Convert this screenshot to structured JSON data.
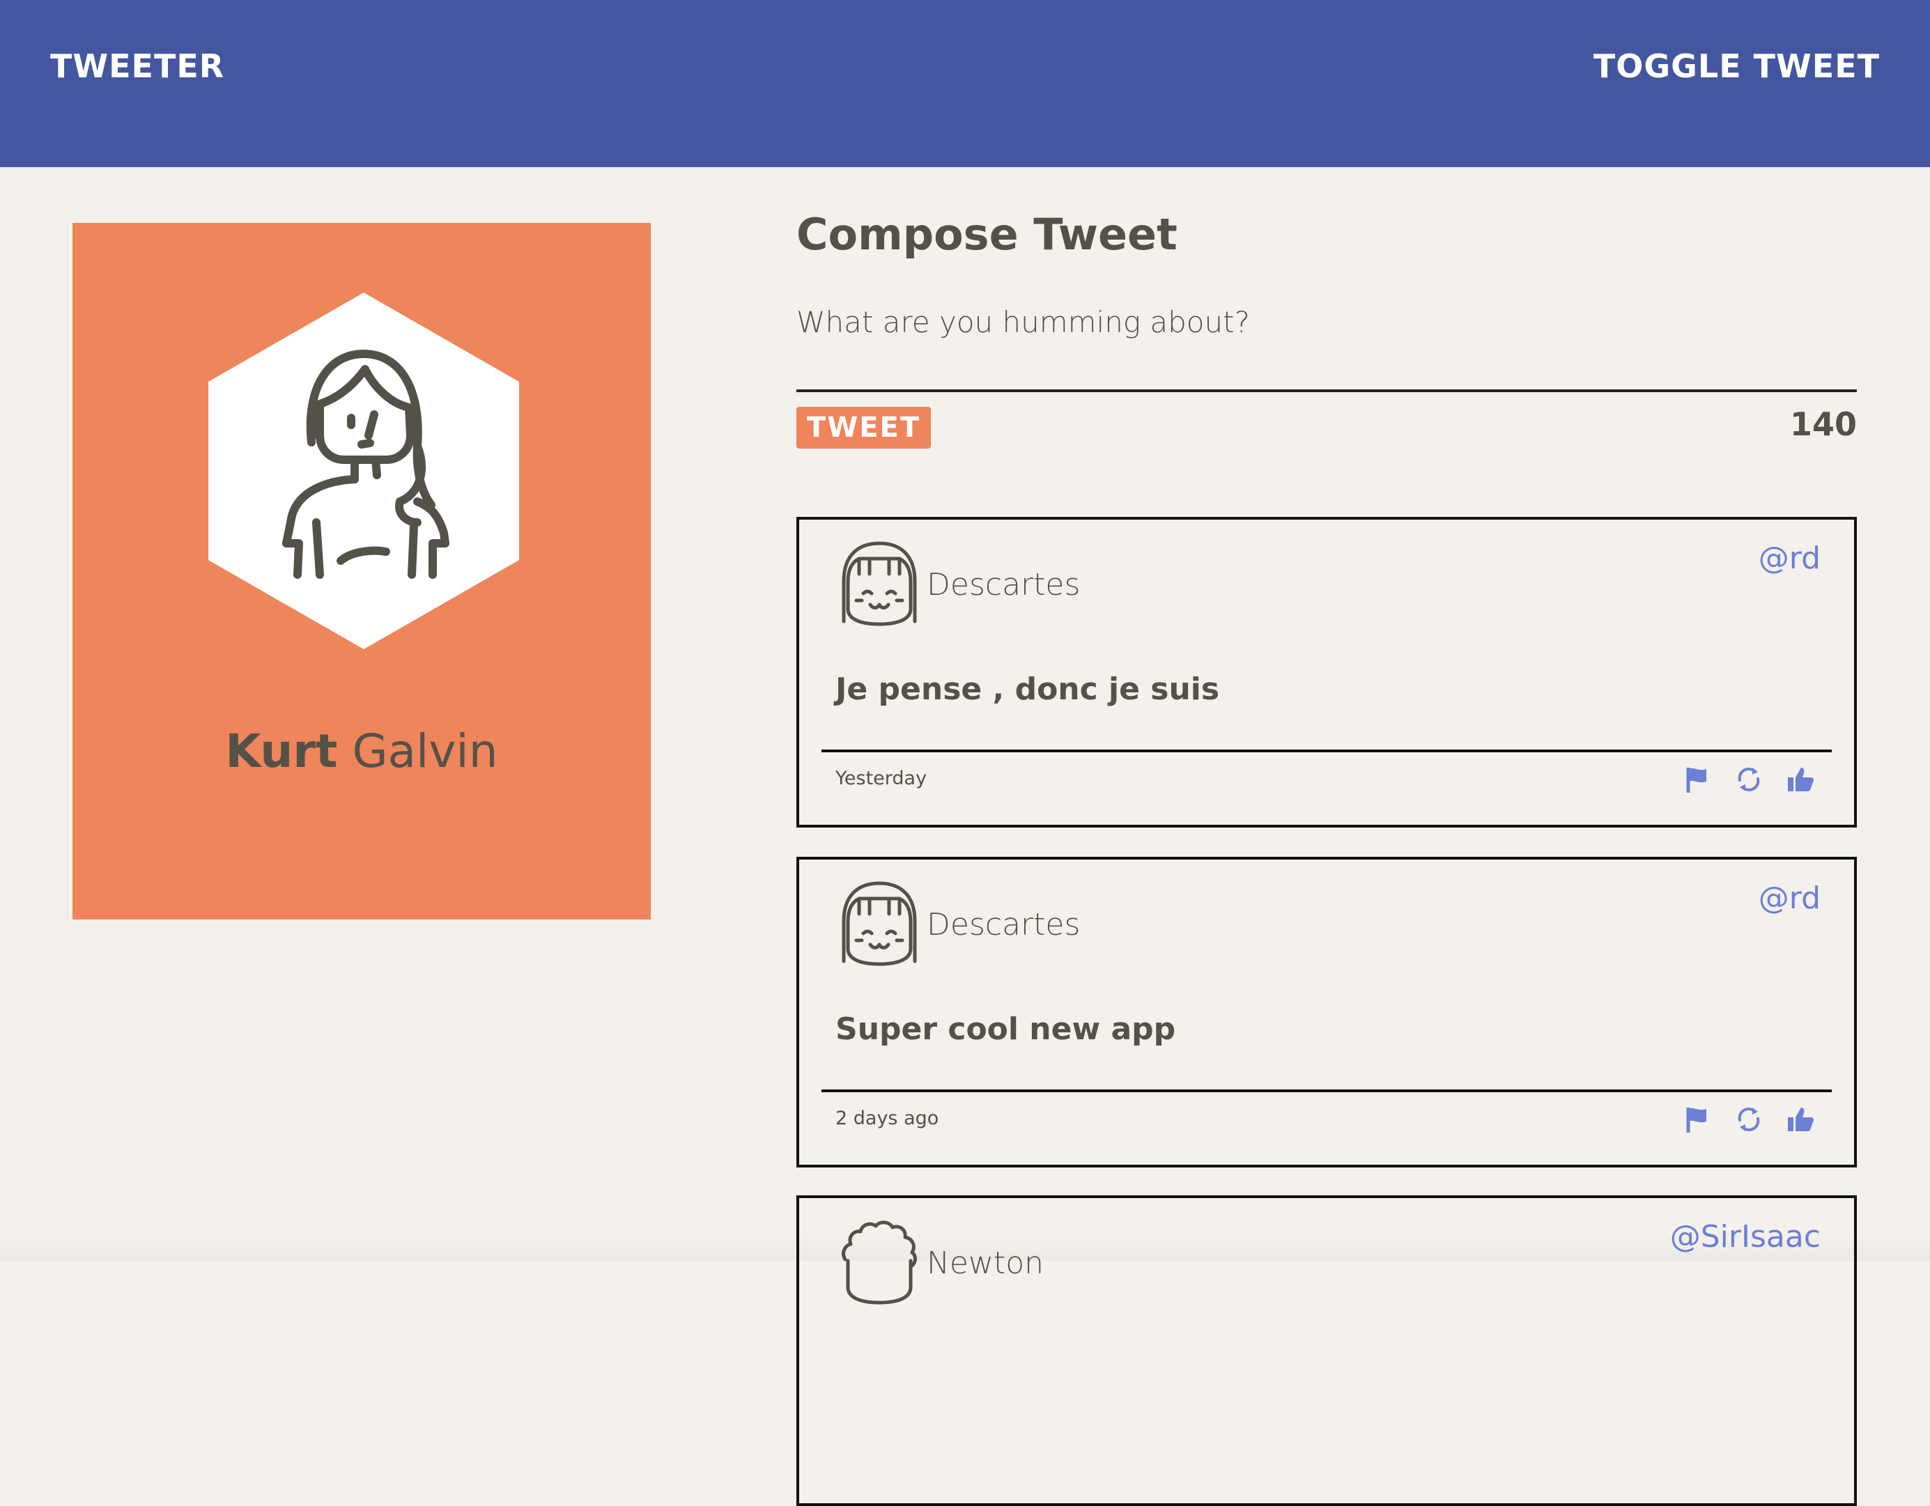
{
  "nav": {
    "brand": "TWEETER",
    "toggle_label": "TOGGLE TWEET"
  },
  "profile": {
    "first_name": "Kurt",
    "last_name": "Galvin",
    "avatar_icon": "girl-avatar-icon",
    "card_color": "#ef855b"
  },
  "compose": {
    "title": "Compose Tweet",
    "placeholder": "What are you humming about?",
    "value": "",
    "button_label": "TWEET",
    "char_count": "140"
  },
  "tweets": [
    {
      "author": "Descartes",
      "handle": "@rd",
      "content": "Je pense , donc je suis",
      "time": "Yesterday",
      "avatar_icon": "bob-hair-avatar-icon"
    },
    {
      "author": "Descartes",
      "handle": "@rd",
      "content": "Super cool new app",
      "time": "2 days ago",
      "avatar_icon": "bob-hair-avatar-icon"
    },
    {
      "author": "Newton",
      "handle": "@SirIsaac",
      "content": "",
      "time": "",
      "avatar_icon": "curly-hair-avatar-icon"
    }
  ],
  "colors": {
    "nav": "#4357a0",
    "accent": "#ef855b",
    "link": "#6c80d6",
    "background": "#f4f1ec",
    "text": "#545149"
  }
}
